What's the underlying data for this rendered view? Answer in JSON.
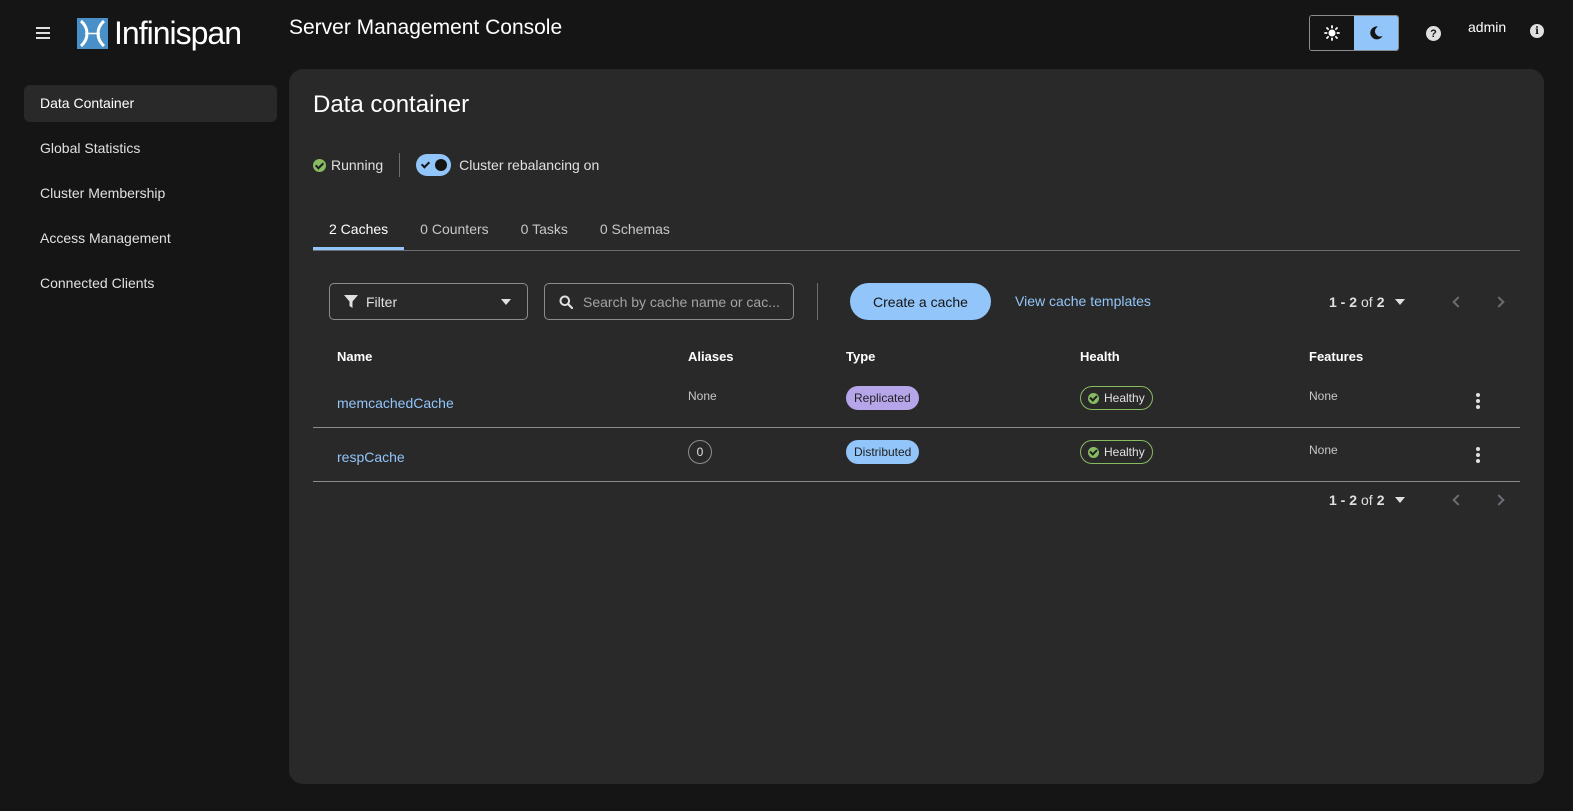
{
  "header": {
    "brand": "Infinispan",
    "app_title": "Server Management Console",
    "user": "admin",
    "help_glyph": "?",
    "info_glyph": "i"
  },
  "sidebar": {
    "items": [
      {
        "label": "Data Container",
        "active": true
      },
      {
        "label": "Global Statistics",
        "active": false
      },
      {
        "label": "Cluster Membership",
        "active": false
      },
      {
        "label": "Access Management",
        "active": false
      },
      {
        "label": "Connected Clients",
        "active": false
      }
    ]
  },
  "main": {
    "title": "Data container",
    "status": "Running",
    "rebalancing_label": "Cluster rebalancing on",
    "rebalancing_on": true,
    "tabs": [
      {
        "label": "2 Caches",
        "active": true
      },
      {
        "label": "0 Counters",
        "active": false
      },
      {
        "label": "0 Tasks",
        "active": false
      },
      {
        "label": "0 Schemas",
        "active": false
      }
    ],
    "toolbar": {
      "filter_label": "Filter",
      "search_placeholder": "Search by cache name or cac...",
      "create_label": "Create a cache",
      "templates_label": "View cache templates"
    },
    "pagination": {
      "range": "1 - 2",
      "of": "of",
      "total": "2"
    },
    "table": {
      "columns": [
        "Name",
        "Aliases",
        "Type",
        "Health",
        "Features"
      ],
      "rows": [
        {
          "name": "memcachedCache",
          "aliases": "None",
          "type": "Replicated",
          "health": "Healthy",
          "features": "None"
        },
        {
          "name": "respCache",
          "aliases": "0",
          "type": "Distributed",
          "health": "Healthy",
          "features": "None"
        }
      ]
    }
  },
  "colors": {
    "accent": "#92c5f9",
    "healthy": "#87bb62",
    "replicated": "#b6a6e9",
    "background": "#151515",
    "card": "#292929"
  }
}
